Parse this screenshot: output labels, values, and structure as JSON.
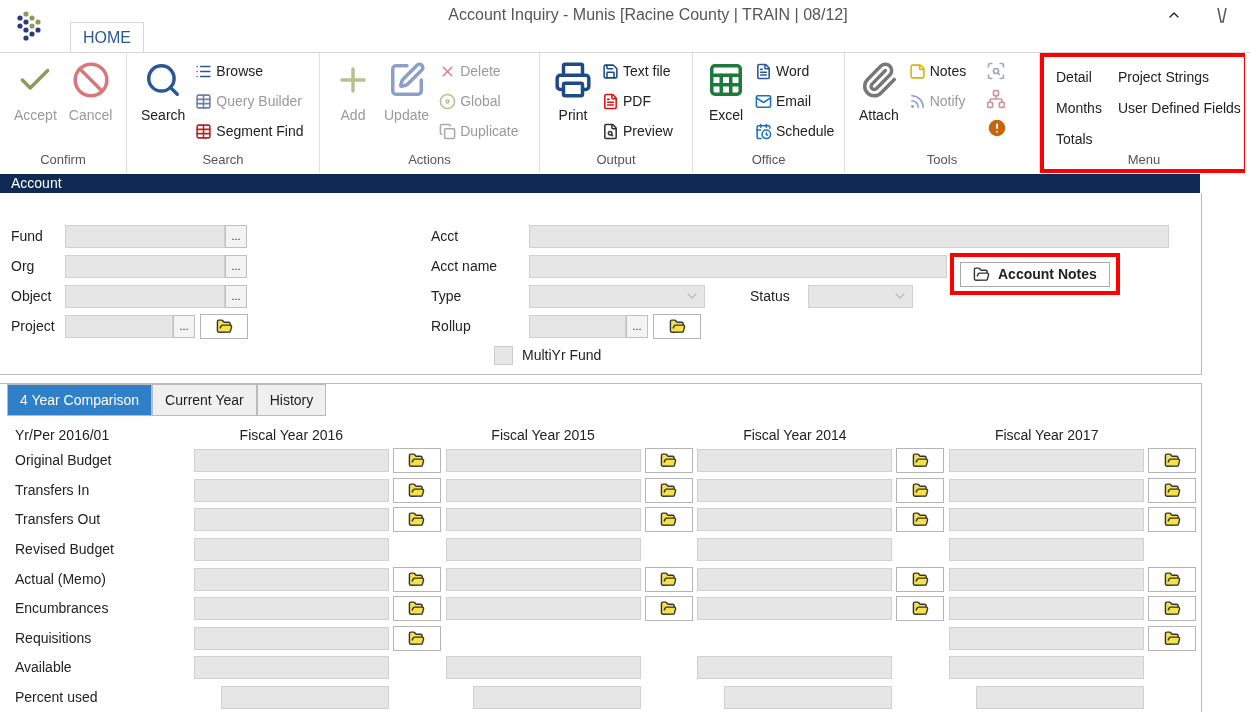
{
  "window": {
    "title": "Account Inquiry - Munis [Racine County | TRAIN | 08/12]"
  },
  "ribbon_tabs": [
    {
      "label": "HOME",
      "selected": true
    }
  ],
  "ribbon_groups": [
    {
      "label": "Confirm",
      "highlighted": false,
      "items": [
        {
          "label": "Accept",
          "kind": "large",
          "disabled": true
        },
        {
          "label": "Cancel",
          "kind": "large",
          "disabled": true
        }
      ]
    },
    {
      "label": "Search",
      "highlighted": false,
      "items": [
        {
          "label": "Search",
          "kind": "large",
          "disabled": false
        },
        {
          "label": "Browse",
          "kind": "small",
          "disabled": false
        },
        {
          "label": "Query Builder",
          "kind": "small",
          "disabled": true
        },
        {
          "label": "Segment Find",
          "kind": "small",
          "disabled": false
        }
      ]
    },
    {
      "label": "Actions",
      "highlighted": false,
      "items": [
        {
          "label": "Add",
          "kind": "large",
          "disabled": true
        },
        {
          "label": "Update",
          "kind": "large",
          "disabled": true
        },
        {
          "label": "Delete",
          "kind": "small",
          "disabled": true
        },
        {
          "label": "Global",
          "kind": "small",
          "disabled": true
        },
        {
          "label": "Duplicate",
          "kind": "small",
          "disabled": true
        }
      ]
    },
    {
      "label": "Output",
      "highlighted": false,
      "items": [
        {
          "label": "Print",
          "kind": "large",
          "disabled": false
        },
        {
          "label": "Text file",
          "kind": "small",
          "disabled": false
        },
        {
          "label": "PDF",
          "kind": "small",
          "disabled": false
        },
        {
          "label": "Preview",
          "kind": "small",
          "disabled": false
        }
      ]
    },
    {
      "label": "Office",
      "highlighted": false,
      "items": [
        {
          "label": "Excel",
          "kind": "large",
          "disabled": false
        },
        {
          "label": "Word",
          "kind": "small",
          "disabled": false
        },
        {
          "label": "Email",
          "kind": "small",
          "disabled": false
        },
        {
          "label": "Schedule",
          "kind": "small",
          "disabled": false
        }
      ]
    },
    {
      "label": "Tools",
      "highlighted": false,
      "items": [
        {
          "label": "Attach",
          "kind": "large",
          "disabled": false
        },
        {
          "label": "Notes",
          "kind": "small",
          "disabled": false
        },
        {
          "label": "Notify",
          "kind": "small",
          "disabled": true
        }
      ]
    },
    {
      "label": "Menu",
      "highlighted": true,
      "items": [
        {
          "label": "Detail",
          "kind": "text",
          "disabled": false
        },
        {
          "label": "Months",
          "kind": "text",
          "disabled": false
        },
        {
          "label": "Totals",
          "kind": "text",
          "disabled": false
        },
        {
          "label": "Project Strings",
          "kind": "text",
          "disabled": false
        },
        {
          "label": "User Defined Fields",
          "kind": "text",
          "disabled": false
        }
      ]
    }
  ],
  "section": {
    "title": "Account"
  },
  "left_fields": [
    {
      "label": "Fund",
      "kind": "lookup",
      "button": "..."
    },
    {
      "label": "Org",
      "kind": "lookup",
      "button": "..."
    },
    {
      "label": "Object",
      "kind": "lookup",
      "button": "..."
    },
    {
      "label": "Project",
      "kind": "lookup_folder",
      "button": "..."
    }
  ],
  "right_fields": [
    {
      "label": "Acct",
      "kind": "text"
    },
    {
      "label": "Acct name",
      "kind": "text"
    },
    {
      "label": "Type",
      "kind": "dropdown"
    },
    {
      "label": "Rollup",
      "kind": "lookup_folder",
      "button": "..."
    }
  ],
  "status": {
    "label": "Status"
  },
  "account_notes": {
    "label": "Account Notes",
    "highlighted": true
  },
  "multiyr_fund": {
    "label": "MultiYr Fund",
    "checked": false
  },
  "detail_tabs": [
    {
      "label": "4 Year Comparison",
      "selected": true
    },
    {
      "label": "Current Year",
      "selected": false
    },
    {
      "label": "History",
      "selected": false
    }
  ],
  "grid": {
    "period": "Yr/Per 2016/01",
    "columns": [
      "Fiscal Year 2016",
      "Fiscal Year 2015",
      "Fiscal Year 2014",
      "Fiscal Year 2017"
    ],
    "rows": [
      {
        "label": "Original Budget",
        "kind": "amount",
        "cells": [
          {
            "kind": "field_notes"
          },
          {
            "kind": "field_notes"
          },
          {
            "kind": "field_notes"
          },
          {
            "kind": "field_notes"
          }
        ]
      },
      {
        "label": "Transfers In",
        "kind": "amount",
        "cells": [
          {
            "kind": "field_notes"
          },
          {
            "kind": "field_notes"
          },
          {
            "kind": "field_notes"
          },
          {
            "kind": "field_notes"
          }
        ]
      },
      {
        "label": "Transfers Out",
        "kind": "amount",
        "cells": [
          {
            "kind": "field_notes"
          },
          {
            "kind": "field_notes"
          },
          {
            "kind": "field_notes"
          },
          {
            "kind": "field_notes"
          }
        ]
      },
      {
        "label": "Revised Budget",
        "kind": "amount",
        "cells": [
          {
            "kind": "field"
          },
          {
            "kind": "field"
          },
          {
            "kind": "field"
          },
          {
            "kind": "field"
          }
        ]
      },
      {
        "label": "Actual (Memo)",
        "kind": "amount",
        "cells": [
          {
            "kind": "field_notes"
          },
          {
            "kind": "field_notes"
          },
          {
            "kind": "field_notes"
          },
          {
            "kind": "field_notes"
          }
        ]
      },
      {
        "label": "Encumbrances",
        "kind": "amount",
        "cells": [
          {
            "kind": "field_notes"
          },
          {
            "kind": "field_notes"
          },
          {
            "kind": "field_notes"
          },
          {
            "kind": "field_notes"
          }
        ]
      },
      {
        "label": "Requisitions",
        "kind": "amount",
        "cells": [
          {
            "kind": "field_notes"
          },
          {
            "kind": "empty"
          },
          {
            "kind": "empty"
          },
          {
            "kind": "field_notes"
          }
        ]
      },
      {
        "label": "Available",
        "kind": "amount",
        "cells": [
          {
            "kind": "field"
          },
          {
            "kind": "field"
          },
          {
            "kind": "field"
          },
          {
            "kind": "field"
          }
        ]
      },
      {
        "label": "Percent used",
        "kind": "percent",
        "cells": [
          {
            "kind": "field"
          },
          {
            "kind": "field"
          },
          {
            "kind": "field"
          },
          {
            "kind": "field"
          }
        ]
      }
    ]
  }
}
